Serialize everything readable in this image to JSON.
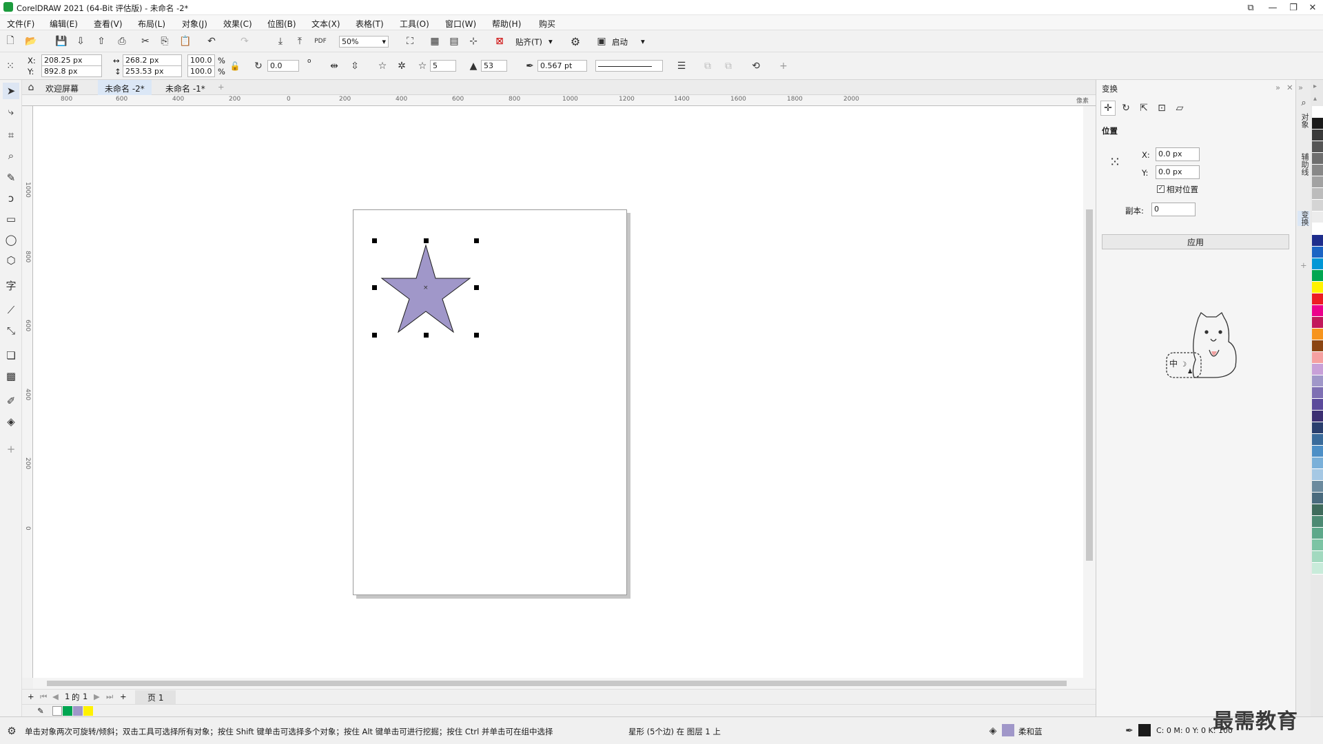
{
  "app": {
    "title": "CorelDRAW 2021 (64-Bit 评估版) - 未命名 -2*"
  },
  "menu": [
    "文件(F)",
    "编辑(E)",
    "查看(V)",
    "布局(L)",
    "对象(J)",
    "效果(C)",
    "位图(B)",
    "文本(X)",
    "表格(T)",
    "工具(O)",
    "窗口(W)",
    "帮助(H)",
    "购买"
  ],
  "toolbar": {
    "zoom": "50%",
    "snap_label": "贴齐(T)",
    "launch_label": "启动"
  },
  "props": {
    "x_label": "X:",
    "x": "208.25 px",
    "y_label": "Y:",
    "y": "892.8 px",
    "w": "268.2 px",
    "h": "253.53 px",
    "sx": "100.0",
    "sy": "100.0",
    "pct": "%",
    "angle": "0.0",
    "deg": "o",
    "points": "5",
    "sharp": "53",
    "outline": "0.567 pt"
  },
  "tabs": [
    "欢迎屏幕",
    "未命名 -2*",
    "未命名 -1*"
  ],
  "ruler": {
    "h_ticks": [
      "800",
      "600",
      "400",
      "200",
      "0",
      "200",
      "400",
      "600",
      "800",
      "1000",
      "1200",
      "1400",
      "1600",
      "1800",
      "2000"
    ],
    "unit": "像素"
  },
  "pagenav": {
    "current": "1",
    "of": "的",
    "total": "1",
    "page_tab": "页 1"
  },
  "panel": {
    "title": "变换",
    "section": "位置",
    "x_label": "X:",
    "x": "0.0 px",
    "y_label": "Y:",
    "y": "0.0 px",
    "relative": "相对位置",
    "copies_label": "副本:",
    "copies": "0",
    "apply": "应用"
  },
  "sidetabs": [
    "对象",
    "辅助线",
    "变换"
  ],
  "palette": [
    "#ffffff",
    "#1a1a1a",
    "#3a3a3a",
    "#555555",
    "#6e6e6e",
    "#888888",
    "#a2a2a2",
    "#bcbcbc",
    "#d4d4d4",
    "#ececec",
    "#ffffff",
    "#1e2d8c",
    "#1b64c4",
    "#0097d6",
    "#00a651",
    "#fff200",
    "#ed1c24",
    "#ec008c",
    "#c2185b",
    "#f7941d",
    "#8b4513",
    "#f5a0a0",
    "#c8a0d8",
    "#a097c9",
    "#7e6fb3",
    "#5b4a9b",
    "#3c2f72",
    "#2a3f6e",
    "#3a6b9b",
    "#4d8fc6",
    "#7ab0d9",
    "#a5c8e4",
    "#6b8a9e",
    "#4a6b7e",
    "#3f6b5c",
    "#4c8a73",
    "#5da88a",
    "#7cc4a4",
    "#a2d9bf",
    "#c8ebda"
  ],
  "doc_palette": [
    "#ffffff",
    "#00a651",
    "#a097c9",
    "#fff200"
  ],
  "status": {
    "hint": "单击对象两次可旋转/倾斜；双击工具可选择所有对象；按住 Shift 键单击可选择多个对象；按住 Alt 键单击可进行挖掘；按住 Ctrl 并单击可在组中选择",
    "object": "星形 (5个边) 在 图层 1 上",
    "fill_name": "柔和蓝",
    "cmyk": "C: 0 M: 0 Y: 0 K: 100"
  },
  "colors": {
    "fill": "#a097c9",
    "outline": "#1a1a1a"
  },
  "watermark": "最需教育"
}
